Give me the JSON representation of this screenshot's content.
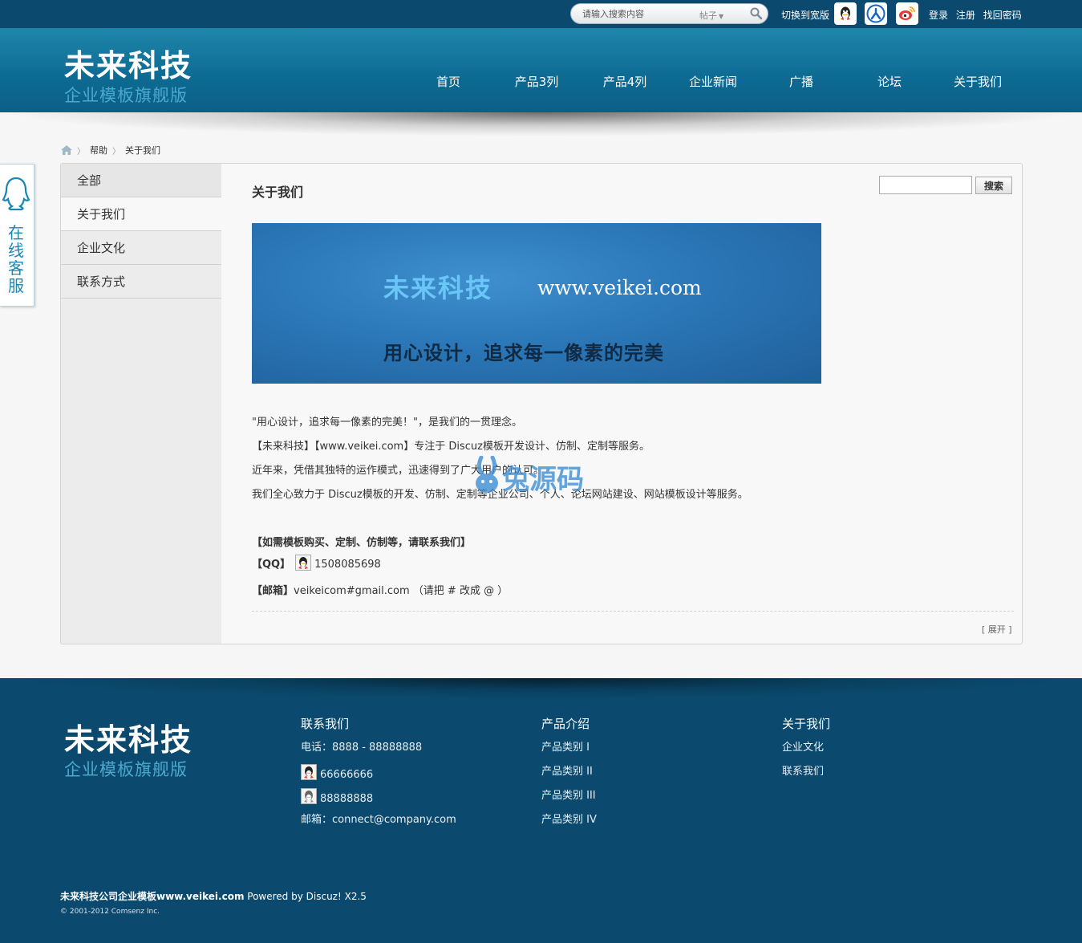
{
  "colors": {
    "topbar": "#0b4a6e",
    "header": "#0d6a92",
    "footer": "#0b4a6e",
    "accent": "#1a86b2"
  },
  "topbar": {
    "search_placeholder": "请输入搜索内容",
    "search_type": "帖子",
    "wide_switch": "切换到宽版",
    "social_icons": [
      "qq-icon",
      "renren-icon",
      "weibo-icon"
    ],
    "links": [
      "登录",
      "注册",
      "找回密码"
    ]
  },
  "logo": {
    "line1": "未来科技",
    "line2": "企业模板旗舰版"
  },
  "nav": {
    "items": [
      "首页",
      "产品3列",
      "产品4列",
      "企业新闻",
      "广播",
      "论坛",
      "关于我们"
    ]
  },
  "breadcrumb": {
    "items": [
      "帮助",
      "关于我们"
    ]
  },
  "service_tab": {
    "label": "在线客服"
  },
  "sidebar": {
    "items": [
      "全部",
      "关于我们",
      "企业文化",
      "联系方式"
    ],
    "active_index": 1
  },
  "main": {
    "title": "关于我们",
    "search_button": "搜索",
    "banner": {
      "title_cn": "未来科技",
      "url": "www.veikei.com",
      "slogan": "用心设计，追求每一像素的完美"
    },
    "paragraphs": [
      "\"用心设计，追求每一像素的完美！\"，是我们的一贯理念。",
      "【未来科技】【www.veikei.com】专注于 Discuz模板开发设计、仿制、定制等服务。",
      "近年来，凭借其独特的运作模式，迅速得到了广大用户的认可。",
      "我们全心致力于 Discuz模板的开发、仿制、定制等企业公司、个人、论坛网站建设、网站模板设计等服务。"
    ],
    "contact_heading": "【如需模板购买、定制、仿制等，请联系我们】",
    "qq_label": "【QQ】",
    "qq_number": "1508085698",
    "email_label": "【邮箱】",
    "email_value": "veikeicom#gmail.com （请把 # 改成 @ ）",
    "expand": "[ 展开 ]"
  },
  "watermark": {
    "text": "兔源码"
  },
  "footer": {
    "logo": {
      "line1": "未来科技",
      "line2": "企业模板旗舰版"
    },
    "contact": {
      "heading": "联系我们",
      "phone": "电话：8888 - 88888888",
      "qq1": "66666666",
      "qq2": "88888888",
      "email": "邮箱：connect@company.com"
    },
    "products": {
      "heading": "产品介绍",
      "items": [
        "产品类别 I",
        "产品类别 II",
        "产品类别 III",
        "产品类别 IV"
      ]
    },
    "about": {
      "heading": "关于我们",
      "items": [
        "企业文化",
        "联系我们"
      ]
    },
    "copyright_bold": "未来科技公司企业模板www.veikei.com",
    "copyright_rest": " Powered by Discuz! X2.5",
    "copyright_small": "© 2001-2012 Comsenz Inc."
  }
}
